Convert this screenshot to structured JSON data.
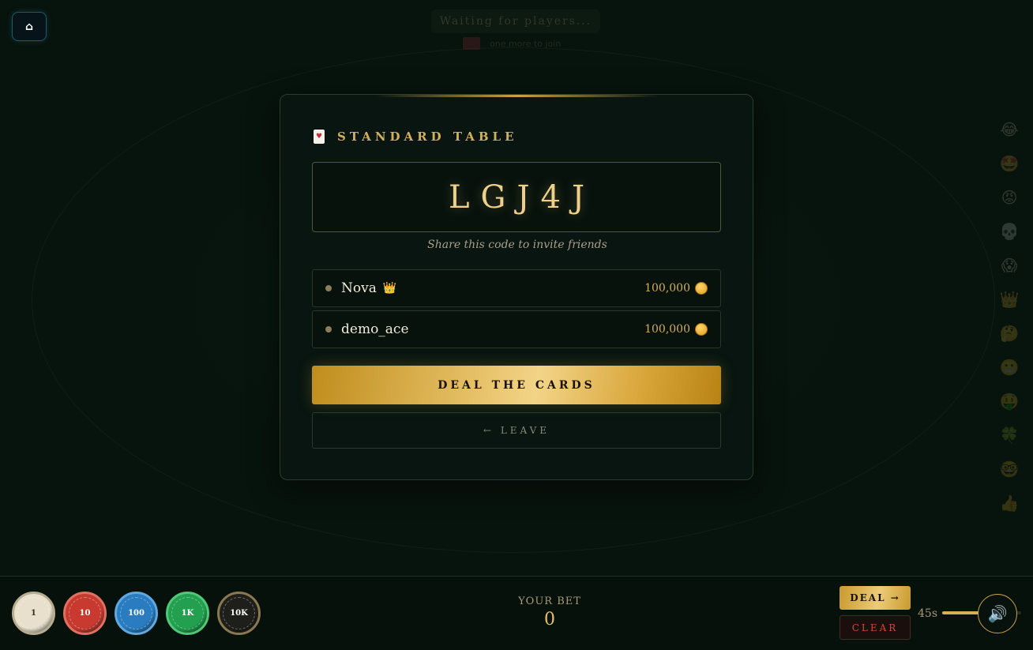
{
  "home": {
    "icon": "home-icon",
    "glyph": "⌂"
  },
  "waiting": {
    "banner": "Waiting for players...",
    "sub": "one more to join"
  },
  "emoji_rail": [
    "😂",
    "🤩",
    "😡",
    "💀",
    "😱",
    "👑",
    "🤔",
    "😬",
    "🤑",
    "🍀",
    "🤓",
    "👍"
  ],
  "panel": {
    "card_icon_glyph": "🃏",
    "title": "STANDARD TABLE",
    "room_code": "LGJ4J",
    "share_text": "Share this code to invite friends",
    "players": [
      {
        "name": "Nova",
        "host_badge": "👑",
        "chips": "100,000"
      },
      {
        "name": "demo_ace",
        "host_badge": "",
        "chips": "100,000"
      }
    ],
    "deal_cards_label": "DEAL THE CARDS",
    "leave_label": "← LEAVE"
  },
  "bottom": {
    "chips": [
      {
        "label": "1",
        "color": "#e8e0cc",
        "text_color": "#3a3020",
        "ring": "#b8ac90"
      },
      {
        "label": "10",
        "color": "#c83a30",
        "text_color": "#ffffff",
        "ring": "#e07060"
      },
      {
        "label": "100",
        "color": "#2a7cc0",
        "text_color": "#ffffff",
        "ring": "#60a8e0"
      },
      {
        "label": "1K",
        "color": "#22a050",
        "text_color": "#ffffff",
        "ring": "#50c878"
      },
      {
        "label": "10K",
        "color": "#1e1e1a",
        "text_color": "#ffffff",
        "ring": "#8a7850"
      }
    ],
    "bet_label": "YOUR BET",
    "bet_value": "0",
    "deal_label": "DEAL →",
    "clear_label": "CLEAR",
    "timer_value": "45",
    "timer_unit": "s",
    "volume_level": 0.7,
    "sound_icon": "speaker-icon",
    "sound_glyph": "🔊"
  },
  "colors": {
    "gold": "#d4af5a",
    "felt": "#07130d",
    "clear_red": "#d04a3a"
  }
}
